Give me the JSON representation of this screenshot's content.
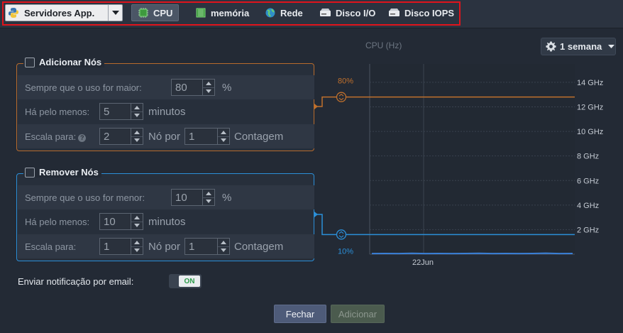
{
  "toolbar": {
    "app_select": "Servidores App.",
    "tabs": [
      {
        "label": "CPU",
        "icon": "cpu-icon",
        "active": true
      },
      {
        "label": "memória",
        "icon": "memory-icon",
        "active": false
      },
      {
        "label": "Rede",
        "icon": "globe-icon",
        "active": false
      },
      {
        "label": "Disco I/O",
        "icon": "disk-icon",
        "active": false
      },
      {
        "label": "Disco IOPS",
        "icon": "disk-icon",
        "active": false
      }
    ]
  },
  "period": {
    "label": "1 semana"
  },
  "add_nodes": {
    "title": "Adicionar Nós",
    "checked": false,
    "threshold_label": "Sempre que o uso for maior:",
    "threshold_value": "80",
    "threshold_unit": "%",
    "duration_label": "Há pelo menos:",
    "duration_value": "5",
    "duration_unit": "minutos",
    "scale_label": "Escala para:",
    "scale_value": "2",
    "scale_per": "Nó por",
    "scale_count": "1",
    "scale_count_unit": "Contagem"
  },
  "remove_nodes": {
    "title": "Remover Nós",
    "checked": false,
    "threshold_label": "Sempre que o uso for menor:",
    "threshold_value": "10",
    "threshold_unit": "%",
    "duration_label": "Há pelo menos:",
    "duration_value": "10",
    "duration_unit": "minutos",
    "scale_label": "Escala para:",
    "scale_value": "1",
    "scale_per": "Nó por",
    "scale_count": "1",
    "scale_count_unit": "Contagem"
  },
  "chart_data": {
    "type": "line",
    "title": "CPU (Hz)",
    "x_tick_labels": [
      "22Jun"
    ],
    "y_tick_labels": [
      "2 GHz",
      "4 GHz",
      "6 GHz",
      "8 GHz",
      "10 GHz",
      "12 GHz",
      "14 GHz"
    ],
    "y_ticks_ghz": [
      2,
      4,
      6,
      8,
      10,
      12,
      14
    ],
    "ylim_ghz": [
      0,
      15.5
    ],
    "upper_threshold": {
      "label": "80%",
      "value_ghz": 12.8,
      "color": "#c0702c"
    },
    "lower_threshold": {
      "label": "10%",
      "value_ghz": 1.6,
      "color": "#2b8fd8"
    },
    "series": [
      {
        "color": "#3a7fd6",
        "values_ghz": [
          0.05,
          0.06,
          0.05,
          0.07,
          0.05,
          0.06,
          0.05,
          0.06,
          0.07,
          0.05,
          0.06,
          0.05,
          0.06,
          0.08,
          0.05,
          0.06
        ]
      }
    ]
  },
  "notification": {
    "label": "Enviar notificação por email:",
    "toggle": "ON"
  },
  "buttons": {
    "close": "Fechar",
    "add": "Adicionar"
  }
}
